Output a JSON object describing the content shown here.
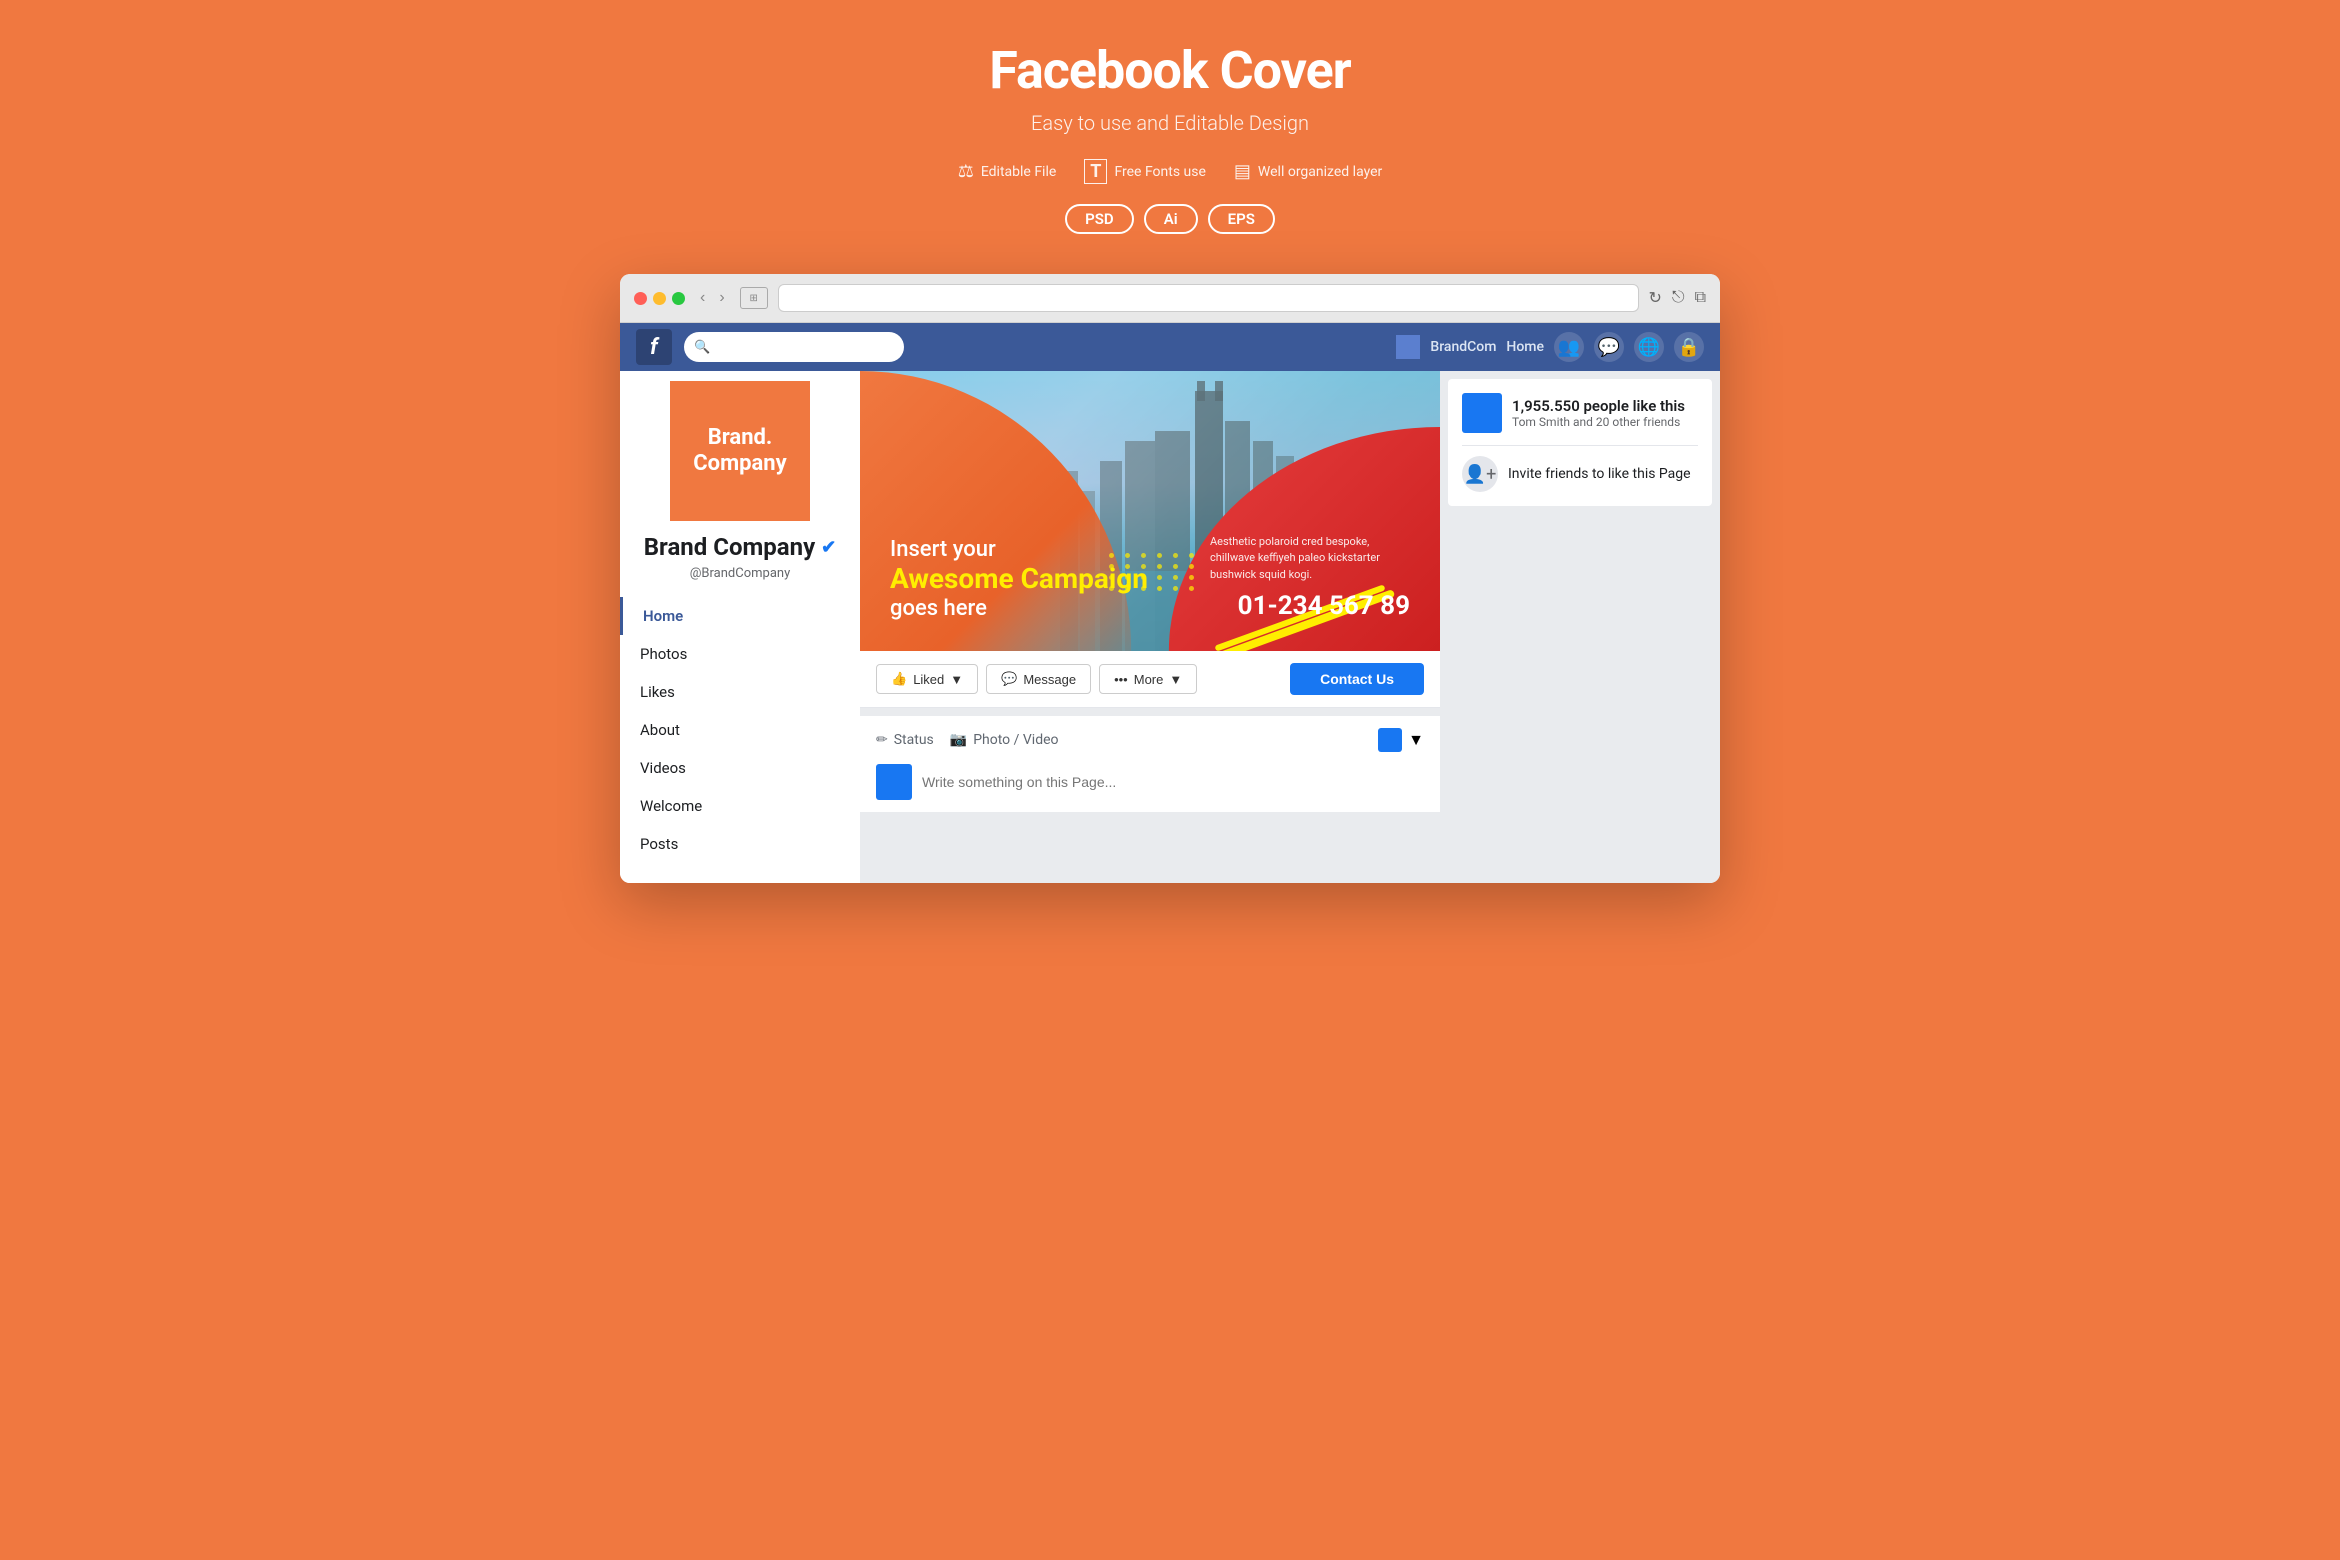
{
  "header": {
    "title": "Facebook Cover",
    "subtitle": "Easy to use and Editable Design",
    "features": [
      {
        "icon": "⚖",
        "label": "Editable File"
      },
      {
        "icon": "T",
        "label": "Free Fonts use"
      },
      {
        "icon": "▤",
        "label": "Well organized layer"
      }
    ],
    "badges": [
      "PSD",
      "Ai",
      "EPS"
    ]
  },
  "browser": {
    "address_placeholder": ""
  },
  "facebook": {
    "nav": {
      "brand_label": "BrandCom",
      "home_label": "Home",
      "logo": "f"
    },
    "profile": {
      "pic_line1": "Brand.",
      "pic_line2": "Company",
      "name_line1": "Brand",
      "name_line2": "Company",
      "handle": "@BrandCompany"
    },
    "menu_items": [
      "Home",
      "Photos",
      "Likes",
      "About",
      "Videos",
      "Welcome",
      "Posts"
    ],
    "active_menu": "Home",
    "cover": {
      "insert_text": "Insert your",
      "campaign_text": "Awesome Campaign",
      "goes_text": "goes here",
      "desc": "Aesthetic polaroid cred bespoke, chillwave keffiyeh paleo kickstarter bushwick squid kogi.",
      "phone": "01-234 567 89"
    },
    "actions": {
      "liked_label": "Liked",
      "message_label": "Message",
      "more_label": "More",
      "contact_label": "Contact Us"
    },
    "post": {
      "status_label": "Status",
      "photo_video_label": "Photo / Video",
      "placeholder": "Write something on this Page..."
    },
    "likes_box": {
      "count": "1,955.550 people like this",
      "friends": "Tom Smith and 20 other friends",
      "invite": "Invite friends to like this Page"
    }
  }
}
